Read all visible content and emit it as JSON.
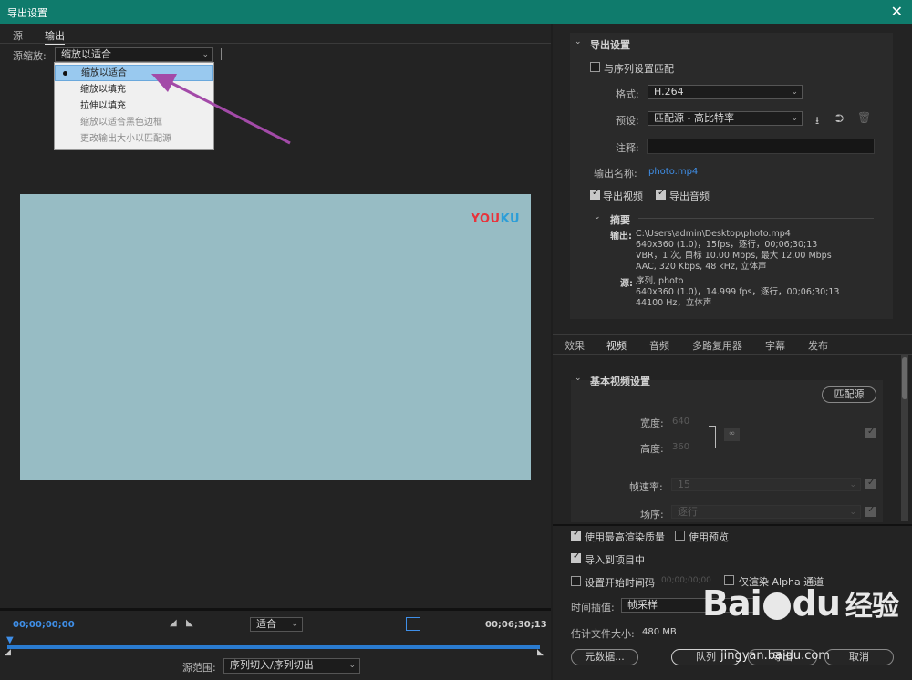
{
  "window": {
    "title": "导出设置",
    "close": "✕"
  },
  "left": {
    "tabs": [
      "源",
      "输出"
    ],
    "scale_label": "源缩放:",
    "scale_value": "缩放以适合",
    "dropdown_items": [
      {
        "label": "缩放以适合",
        "selected": true,
        "enabled": true
      },
      {
        "label": "缩放以填充",
        "selected": false,
        "enabled": true
      },
      {
        "label": "拉伸以填充",
        "selected": false,
        "enabled": true
      },
      {
        "label": "缩放以适合黑色边框",
        "selected": false,
        "enabled": false
      },
      {
        "label": "更改输出大小以匹配源",
        "selected": false,
        "enabled": false
      }
    ],
    "preview_logo": {
      "part1": "YOU",
      "part2": "KU"
    },
    "timecode_start": "00;00;00;00",
    "timecode_end": "00;06;30;13",
    "fit_value": "适合",
    "source_range_label": "源范围:",
    "source_range_value": "序列切入/序列切出"
  },
  "export_settings": {
    "section_title": "导出设置",
    "match_sequence": "与序列设置匹配",
    "format_label": "格式:",
    "format_value": "H.264",
    "preset_label": "预设:",
    "preset_value": "匹配源 - 高比特率",
    "comment_label": "注释:",
    "output_name_label": "输出名称:",
    "output_name_value": "photo.mp4",
    "export_video": "导出视频",
    "export_audio": "导出音频",
    "summary_title": "摘要",
    "output_label": "输出:",
    "output_lines": [
      "C:\\Users\\admin\\Desktop\\photo.mp4",
      "640x360 (1.0)，15fps，逐行，00;06;30;13",
      "VBR，1 次, 目标 10.00 Mbps, 最大 12.00 Mbps",
      "AAC, 320 Kbps, 48  kHz, 立体声"
    ],
    "source_label": "源:",
    "source_lines": [
      "序列, photo",
      "640x360 (1.0)，14.999 fps，逐行，00;06;30;13",
      "44100 Hz，立体声"
    ]
  },
  "settings_tabs": [
    "效果",
    "视频",
    "音频",
    "多路复用器",
    "字幕",
    "发布"
  ],
  "video": {
    "section_title": "基本视频设置",
    "match_source": "匹配源",
    "width_label": "宽度:",
    "width_value": "640",
    "height_label": "高度:",
    "height_value": "360",
    "framerate_label": "帧速率:",
    "framerate_value": "15",
    "field_label": "场序:",
    "field_value": "逐行"
  },
  "bottom": {
    "max_quality": "使用最高渲染质量",
    "use_preview": "使用预览",
    "import_project": "导入到项目中",
    "set_start_tc": "设置开始时间码",
    "start_tc_value": "00;00;00;00",
    "alpha_only": "仅渲染 Alpha 通道",
    "interp_label": "时间插值:",
    "interp_value": "帧采样",
    "filesize_label": "估计文件大小:",
    "filesize_value": "480 MB",
    "metadata_btn": "元数据...",
    "queue_btn": "队列",
    "export_btn": "导出",
    "cancel_btn": "取消"
  },
  "watermark": {
    "brand": "Bai",
    "brand2": "du",
    "sub": "经验",
    "url": "jingyan.baidu.com"
  },
  "colors": {
    "titlebar": "#0f7b6c",
    "accent_blue": "#3f8fe8",
    "preview_bg": "#97bcc4",
    "arrow": "#a34aa8"
  }
}
